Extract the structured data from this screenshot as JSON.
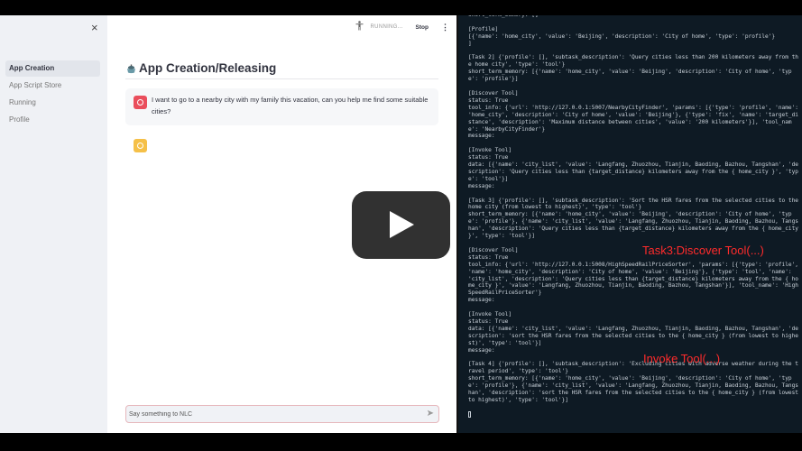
{
  "sidebar": {
    "close_label": "×",
    "items": [
      {
        "label": "App Creation",
        "active": true
      },
      {
        "label": "App Script Store",
        "active": false
      },
      {
        "label": "Running",
        "active": false
      },
      {
        "label": "Profile",
        "active": false
      }
    ]
  },
  "header": {
    "status_icon": "running-person-icon",
    "status_text": "RUNNING...",
    "stop_label": "Stop",
    "menu_icon": "⋮"
  },
  "main": {
    "title_icon": "robot-bowl-icon",
    "title": "App Creation/Releasing",
    "messages": [
      {
        "role": "user",
        "avatar_color": "#ea4e5c",
        "text": "I want to go to a nearby city with my family this vacation, can you help me find some suitable cities?"
      },
      {
        "role": "assistant",
        "avatar_color": "#f5c048",
        "text": ""
      }
    ],
    "chat_input": {
      "placeholder": "Say something to NLC",
      "value": "",
      "send_icon": "➤"
    }
  },
  "video": {
    "play_icon": "play-icon"
  },
  "terminal": {
    "lines": [
      "short_term_memory: []",
      "",
      "[Profile]",
      "[{'name': 'home_city', 'value': 'Beijing', 'description': 'City of home', 'type': 'profile'}",
      "]",
      "",
      "[Task 2] {'profile': [], 'subtask_description': 'Query cities less than 200 kilometers away from the home city', 'type': 'tool'}",
      "short_term_memory: [{'name': 'home_city', 'value': 'Beijing', 'description': 'City of home', 'type': 'profile'}]",
      "",
      "[Discover Tool]",
      "status: True",
      "tool_info: {'url': 'http://127.0.0.1:5007/NearbyCityFinder', 'params': [{'type': 'profile', 'name': 'home_city', 'description': 'City of home', 'value': 'Beijing'}, {'type': 'fix', 'name': 'target_distance', 'description': 'Maximum distance between cities', 'value': '200 kilometers'}], 'tool_name': 'NearbyCityFinder'}",
      "message:",
      "",
      "[Invoke Tool]",
      "status: True",
      "data: [{'name': 'city_list', 'value': 'Langfang, Zhuozhou, Tianjin, Baoding, Bazhou, Tangshan', 'description': 'Query cities less than {target_distance} kilometers away from the { home_city }', 'type': 'tool'}]",
      "message:",
      "",
      "[Task 3] {'profile': [], 'subtask_description': 'Sort the HSR fares from the selected cities to the home city (from lowest to highest)', 'type': 'tool'}",
      "short_term_memory: [{'name': 'home_city', 'value': 'Beijing', 'description': 'City of home', 'type': 'profile'}, {'name': 'city_list', 'value': 'Langfang, Zhuozhou, Tianjin, Baoding, Bazhou, Tangshan', 'description': 'Query cities less than {target_distance} kilometers away from the { home_city }', 'type': 'tool'}]",
      "",
      "[Discover Tool]",
      "status: True",
      "tool_info: {'url': 'http://127.0.0.1:5008/HighSpeedRailPriceSorter', 'params': [{'type': 'profile', 'name': 'home_city', 'description': 'City of home', 'value': 'Beijing'}, {'type': 'tool', 'name': 'city_list', 'description': 'Query cities less than {target_distance} kilometers away from the { home_city }', 'value': 'Langfang, Zhuozhou, Tianjin, Baoding, Bazhou, Tangshan'}], 'tool_name': 'HighSpeedRailPriceSorter'}",
      "message:",
      "",
      "[Invoke Tool]",
      "status: True",
      "data: [{'name': 'city_list', 'value': 'Langfang, Zhuozhou, Tianjin, Baoding, Bazhou, Tangshan', 'description': 'sort the HSR fares from the selected cities to the { home_city } (from lowest to highest)', 'type': 'tool'}]",
      "message:",
      "",
      "[Task 4] {'profile': [], 'subtask_description': 'Excluding cities with adverse weather during the travel period', 'type': 'tool'}",
      "short_term_memory: [{'name': 'home_city', 'value': 'Beijing', 'description': 'City of home', 'type': 'profile'}, {'name': 'city_list', 'value': 'Langfang, Zhuozhou, Tianjin, Baoding, Bazhou, Tangshan', 'description': 'sort the HSR fares from the selected cities to the { home_city } (from lowest to highest)', 'type': 'tool'}]",
      ""
    ],
    "annotations": [
      {
        "text": "Task3:Discover Tool(...)",
        "color": "#ff2b2b"
      },
      {
        "text": "Invoke Tool(...)",
        "color": "#ff2b2b"
      }
    ]
  }
}
